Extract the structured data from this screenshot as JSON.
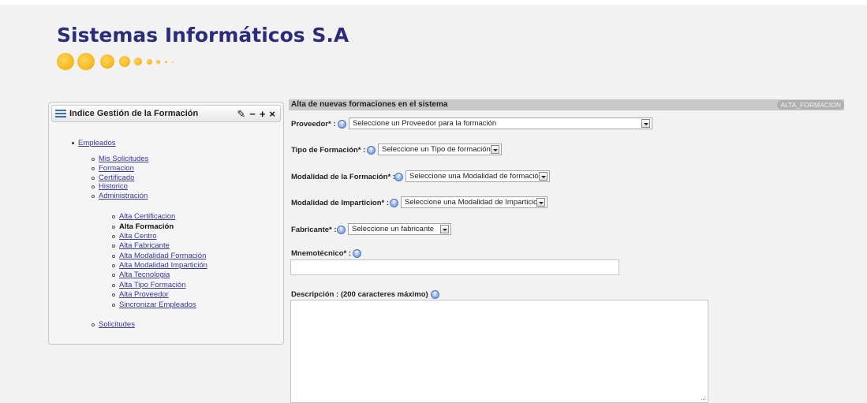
{
  "brand": {
    "name": "Sistemas Informáticos S.A"
  },
  "sidebar": {
    "title": "Indice Gestión de la Formación",
    "tools": [
      "✎",
      "−",
      "+",
      "×"
    ],
    "root": "Empleados",
    "items": [
      "Mis Solicitudes",
      "Formacion",
      "Certificado",
      "Historico",
      "Administración"
    ],
    "admin_items": [
      "Alta Certificacion",
      "Alta Formación",
      "Alta Centro",
      "Alta Fabricante",
      "Alta Modalidad Formación",
      "Alta Modalidad Impartición",
      "Alta Tecnologia",
      "Alta Tipo Formación",
      "Alta Proveedor",
      "Sincronizar Empleados"
    ],
    "last_item": "Solicitudes",
    "current": "Alta Formación"
  },
  "form": {
    "title": "Alta de nuevas formaciones en el sistema",
    "code": "ALTA_FORMACION",
    "proveedor": {
      "label": "Proveedor* :",
      "value": "Seleccione un Proveedor para la formación"
    },
    "tipo": {
      "label": "Tipo de Formación* :",
      "value": "Seleccione un Tipo de formación"
    },
    "modalidad": {
      "label": "Modalidad de la Formación* :",
      "value": "Seleccione una Modalidad de formación"
    },
    "imparticion": {
      "label": "Modalidad de Imparticion* :",
      "value": "Seleccione una Modalidad de Imparticion"
    },
    "fabricante": {
      "label": "Fabricante* :",
      "value": "Seleccione un fabricante"
    },
    "mnemotecnico": {
      "label": "Mnemotécnico* :",
      "value": ""
    },
    "descripcion": {
      "label": "Descripción : (200 caracteres máximo)",
      "value": ""
    }
  },
  "colors": {
    "brand": "#2c2c7a",
    "dots": "#f0a800",
    "link": "#3a3a9a",
    "help": "#5f8fd8"
  }
}
